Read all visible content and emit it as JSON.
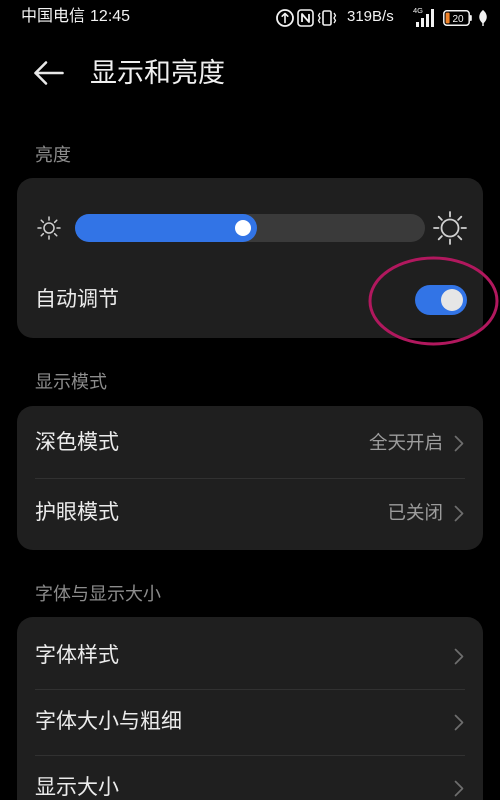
{
  "status_bar": {
    "carrier": "中国电信",
    "time": "12:45",
    "net_speed": "319B/s",
    "network_type": "4G",
    "battery_level": "20",
    "icons": [
      "data-saver-icon",
      "nfc-icon",
      "vibrate-icon",
      "signal-icon",
      "battery-icon",
      "leaf-icon"
    ]
  },
  "header": {
    "title": "显示和亮度",
    "back_icon": "arrow-left-icon"
  },
  "brightness": {
    "section_label": "亮度",
    "level": 0.52,
    "low_icon": "sun-small-icon",
    "high_icon": "sun-large-icon",
    "auto_adjust_label": "自动调节",
    "auto_adjust_on": true
  },
  "display_mode": {
    "section_label": "显示模式",
    "items": [
      {
        "label": "深色模式",
        "value": "全天开启"
      },
      {
        "label": "护眼模式",
        "value": "已关闭"
      }
    ]
  },
  "font_display": {
    "section_label": "字体与显示大小",
    "items": [
      {
        "label": "字体样式"
      },
      {
        "label": "字体大小与粗细"
      },
      {
        "label": "显示大小"
      }
    ]
  },
  "colors": {
    "background": "#000000",
    "card": "#1f1f1f",
    "accent": "#3274e6",
    "section_label": "#8c8c8c",
    "annotation": "#b1185e"
  }
}
